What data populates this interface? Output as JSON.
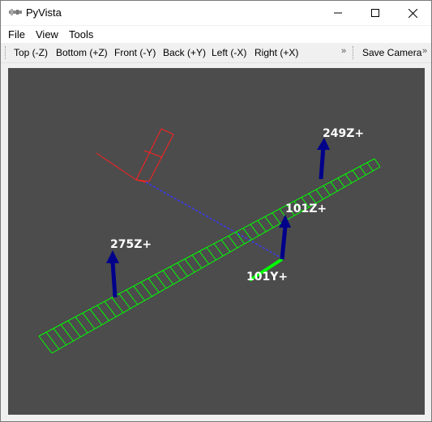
{
  "window": {
    "title": "PyVista",
    "icon_name": "pyvista-logo-icon"
  },
  "menu": {
    "file": "File",
    "view": "View",
    "tools": "Tools"
  },
  "toolbar": {
    "top": "Top (-Z)",
    "bottom": "Bottom (+Z)",
    "front": "Front (-Y)",
    "back": "Back (+Y)",
    "left": "Left (-X)",
    "right": "Right (+X)",
    "overflow1": "»",
    "save_camera": "Save Camera",
    "overflow2": "»"
  },
  "scene": {
    "background_color": "#4c4c4c",
    "labels": {
      "a": "249Z+",
      "b": "101Z+",
      "c": "275Z+",
      "d": "101Y+"
    },
    "colors": {
      "beam": "#00ff00",
      "arrow": "#00008b",
      "axis_x": "#ff2020",
      "axis_y_dashed": "#3a3aff",
      "label": "#ffffff"
    }
  }
}
